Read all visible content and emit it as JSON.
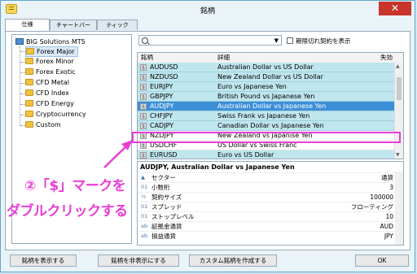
{
  "window": {
    "title": "銘柄",
    "close_label": "✕"
  },
  "tabs": [
    "仕様",
    "チャートバー",
    "ティック"
  ],
  "tree": {
    "root": "BIG Solutions MT5",
    "items": [
      "Forex Major",
      "Forex Minor",
      "Forex Exotic",
      "CFD Metal",
      "CFD Index",
      "CFD Energy",
      "Cryptocurrency",
      "Custom"
    ]
  },
  "search": {
    "value": "",
    "checkbox_label": "期限切れ契約を表示"
  },
  "grid": {
    "headers": [
      "銘柄",
      "詳細",
      "失効"
    ],
    "rows": [
      {
        "symbol": "AUDUSD",
        "desc": "Australian Dollar vs US Dollar"
      },
      {
        "symbol": "NZDUSD",
        "desc": "New Zealand Dollar vs US Dollar"
      },
      {
        "symbol": "EURJPY",
        "desc": "Euro vs Japanese Yen"
      },
      {
        "symbol": "GBPJPY",
        "desc": "British Pound vs Japanese Yen"
      },
      {
        "symbol": "AUDJPY",
        "desc": "Australian Dollar vs Japanese Yen"
      },
      {
        "symbol": "CHFJPY",
        "desc": "Swiss Frank vs Japanese Yen"
      },
      {
        "symbol": "CADJPY",
        "desc": "Canadian Dollar vs Japanese Yen"
      },
      {
        "symbol": "NZDJPY",
        "desc": "New Zealand vs Japanise Yen"
      },
      {
        "symbol": "USDCHF",
        "desc": "US Dollar vs Swiss Franc"
      },
      {
        "symbol": "EURUSD",
        "desc": "Euro vs US Dollar"
      }
    ]
  },
  "detail": {
    "title": "AUDJPY, Australian Dollar vs Japanese Yen",
    "rows": [
      {
        "icon": "▲",
        "label": "セクター",
        "value": "通貨"
      },
      {
        "icon": "01",
        "label": "小数桁",
        "value": "3"
      },
      {
        "icon": "½",
        "label": "契約サイズ",
        "value": "100000"
      },
      {
        "icon": "01",
        "label": "スプレッド",
        "value": "フローティング"
      },
      {
        "icon": "01",
        "label": "ストップレベル",
        "value": "10"
      },
      {
        "icon": "ab",
        "label": "証拠金通貨",
        "value": "AUD"
      },
      {
        "icon": "ab",
        "label": "損益通貨",
        "value": "JPY"
      }
    ]
  },
  "buttons": {
    "show": "銘柄を表示する",
    "hide": "銘柄を非表示にする",
    "create": "カスタム銘柄を作成する",
    "ok": "OK"
  },
  "annotation": {
    "line1": "②「$」マークを",
    "line2": "ダブルクリックする"
  },
  "colors": {
    "highlight": "#ea3dd6",
    "selected_row": "#3c8fd8",
    "row_bg": "#bfe6ee"
  }
}
